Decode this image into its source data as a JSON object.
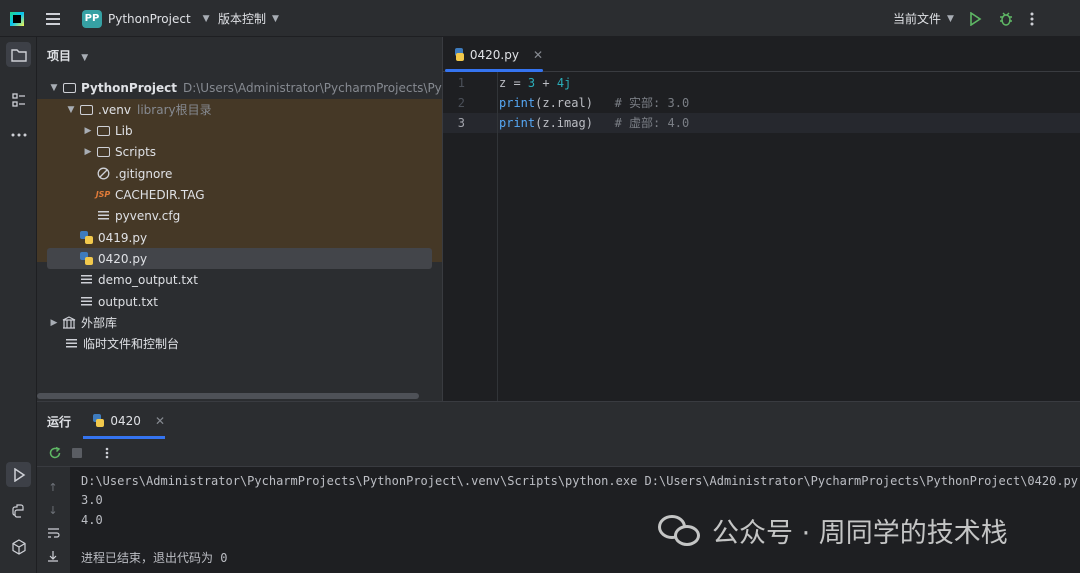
{
  "titlebar": {
    "project_badge": "PP",
    "project_name": "PythonProject",
    "vcs": "版本控制",
    "current_file": "当前文件"
  },
  "project_panel": {
    "title": "项目",
    "root_name": "PythonProject",
    "root_path": "D:\\Users\\Administrator\\PycharmProjects\\PythonProject",
    "venv_name": ".venv",
    "venv_hint": "library根目录",
    "items": {
      "lib": "Lib",
      "scripts": "Scripts",
      "gitignore": ".gitignore",
      "cachedir": "CACHEDIR.TAG",
      "pyvenv": "pyvenv.cfg",
      "f0419": "0419.py",
      "f0420": "0420.py",
      "demo_output": "demo_output.txt",
      "output": "output.txt",
      "external": "外部库",
      "scratches": "临时文件和控制台"
    }
  },
  "editor": {
    "tab_label": "0420.py",
    "line_numbers": [
      "1",
      "2",
      "3"
    ],
    "lines": [
      {
        "a": "z = ",
        "b": "3",
        "c": " + ",
        "d": "4j"
      },
      {
        "fn": "print",
        "args": "(z.real)",
        "comment": "   # 实部: 3.0"
      },
      {
        "fn": "print",
        "args": "(z.imag)",
        "comment": "   # 虚部: 4.0"
      }
    ]
  },
  "run_panel": {
    "title": "运行",
    "tab_label": "0420",
    "output": [
      "D:\\Users\\Administrator\\PycharmProjects\\PythonProject\\.venv\\Scripts\\python.exe D:\\Users\\Administrator\\PycharmProjects\\PythonProject\\0420.py",
      "3.0",
      "4.0",
      "",
      "进程已结束，退出代码为 0"
    ]
  },
  "watermark": "公众号 · 周同学的技术栈"
}
